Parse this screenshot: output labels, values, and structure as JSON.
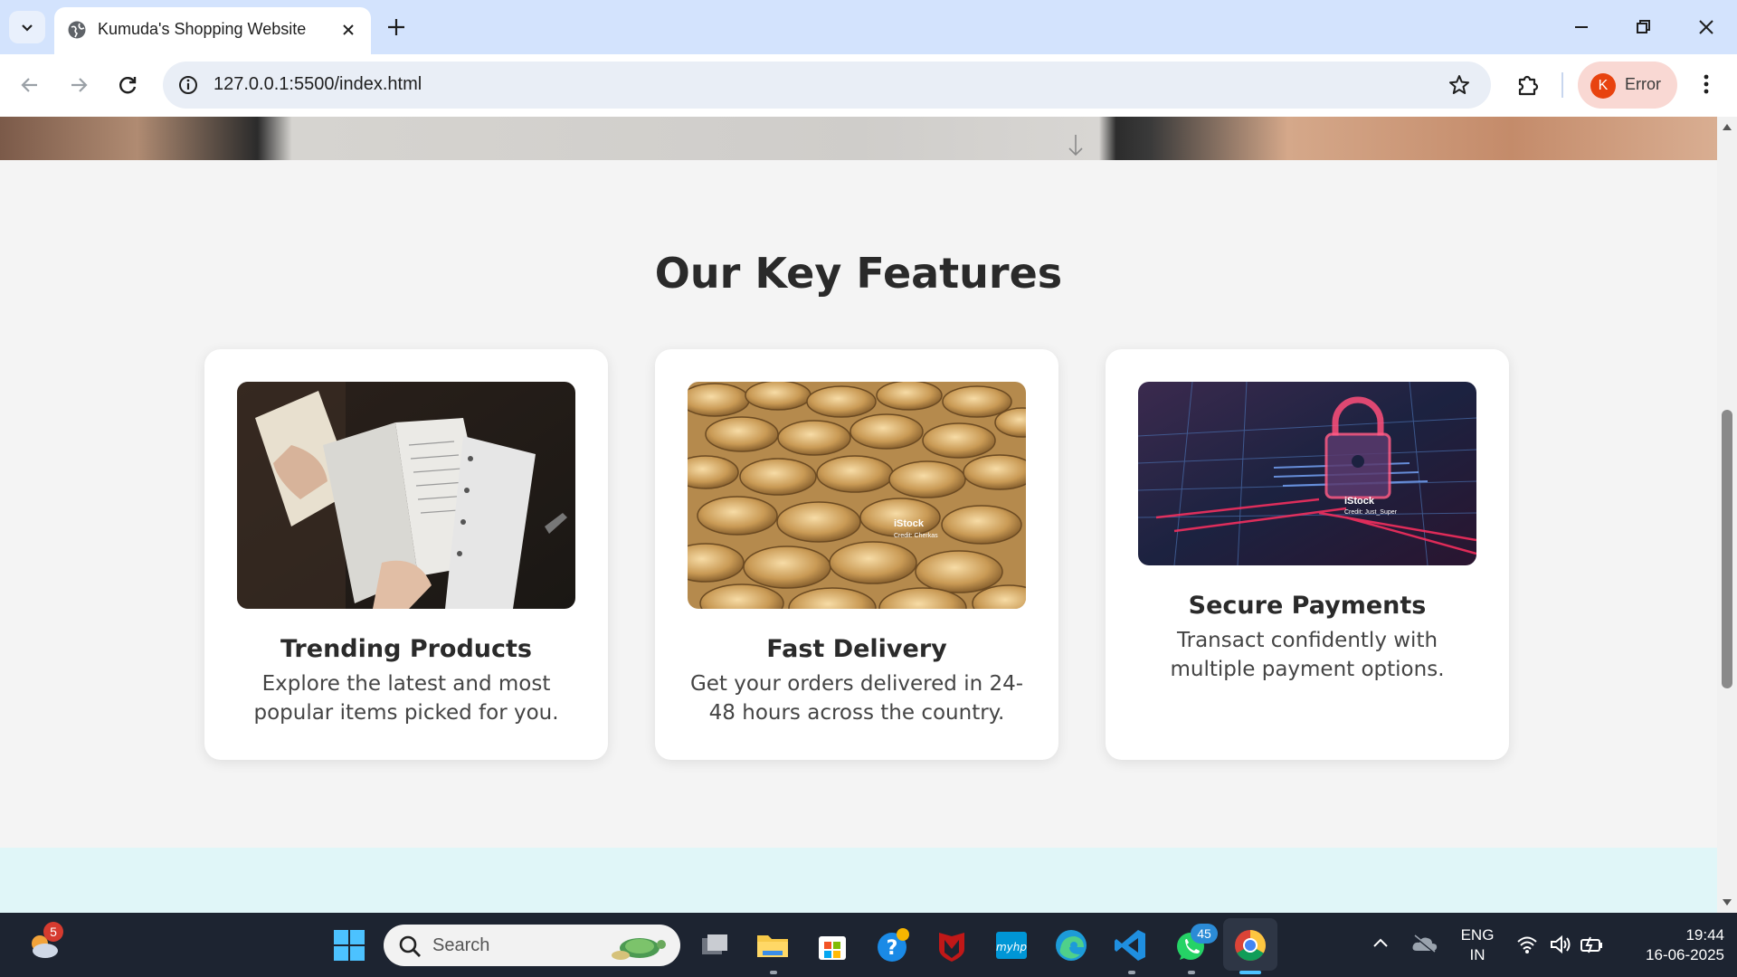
{
  "browser": {
    "tab_title": "Kumuda's Shopping Website",
    "url": "127.0.0.1:5500/index.html",
    "profile_initial": "K",
    "profile_label": "Error"
  },
  "page": {
    "section_title": "Our Key Features",
    "features": [
      {
        "title": "Trending Products",
        "description": "Explore the latest and most popular items picked for you."
      },
      {
        "title": "Fast Delivery",
        "description": "Get your orders delivered in 24-48 hours across the country."
      },
      {
        "title": "Secure Payments",
        "description": "Transact confidently with multiple payment options."
      }
    ],
    "image_watermarks": {
      "coins": {
        "brand": "iStock",
        "credit": "Credit: Cherkas"
      },
      "security": {
        "brand": "iStock",
        "credit": "Credit: Just_Super"
      }
    }
  },
  "taskbar": {
    "weather_badge": "5",
    "search_placeholder": "Search",
    "whatsapp_badge": "45",
    "language": "ENG",
    "region": "IN",
    "time": "19:44",
    "date": "16-06-2025"
  },
  "colors": {
    "tabbar_bg": "#d3e3fd",
    "taskbar_bg": "#1d2431",
    "page_bg": "#f4f4f4",
    "bottom_band": "#e0f6f8",
    "profile_avatar": "#e8430f"
  }
}
